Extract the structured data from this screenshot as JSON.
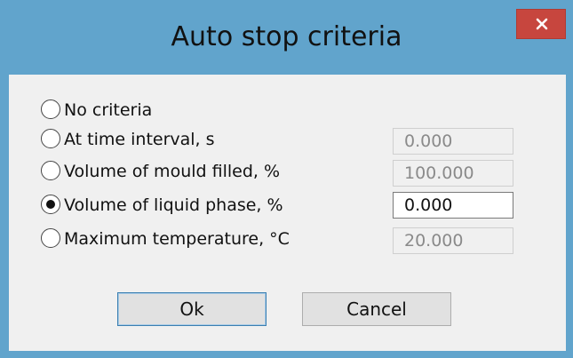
{
  "dialog": {
    "title": "Auto stop criteria",
    "close_symbol": "×"
  },
  "options": [
    {
      "label": "No criteria",
      "selected": false,
      "value": null
    },
    {
      "label": "At time interval, s",
      "selected": false,
      "value": "0.000"
    },
    {
      "label": "Volume of mould filled, %",
      "selected": false,
      "value": "100.000"
    },
    {
      "label": "Volume of liquid phase, %",
      "selected": true,
      "value": "0.000"
    },
    {
      "label": "Maximum temperature, °C",
      "selected": false,
      "value": "20.000"
    }
  ],
  "buttons": {
    "ok_label": "Ok",
    "cancel_label": "Cancel"
  },
  "colors": {
    "title_bar": "#61a4cc",
    "close_button": "#c7463e",
    "client_background": "#f0f0f0"
  },
  "icons": {
    "close": "close-icon"
  }
}
